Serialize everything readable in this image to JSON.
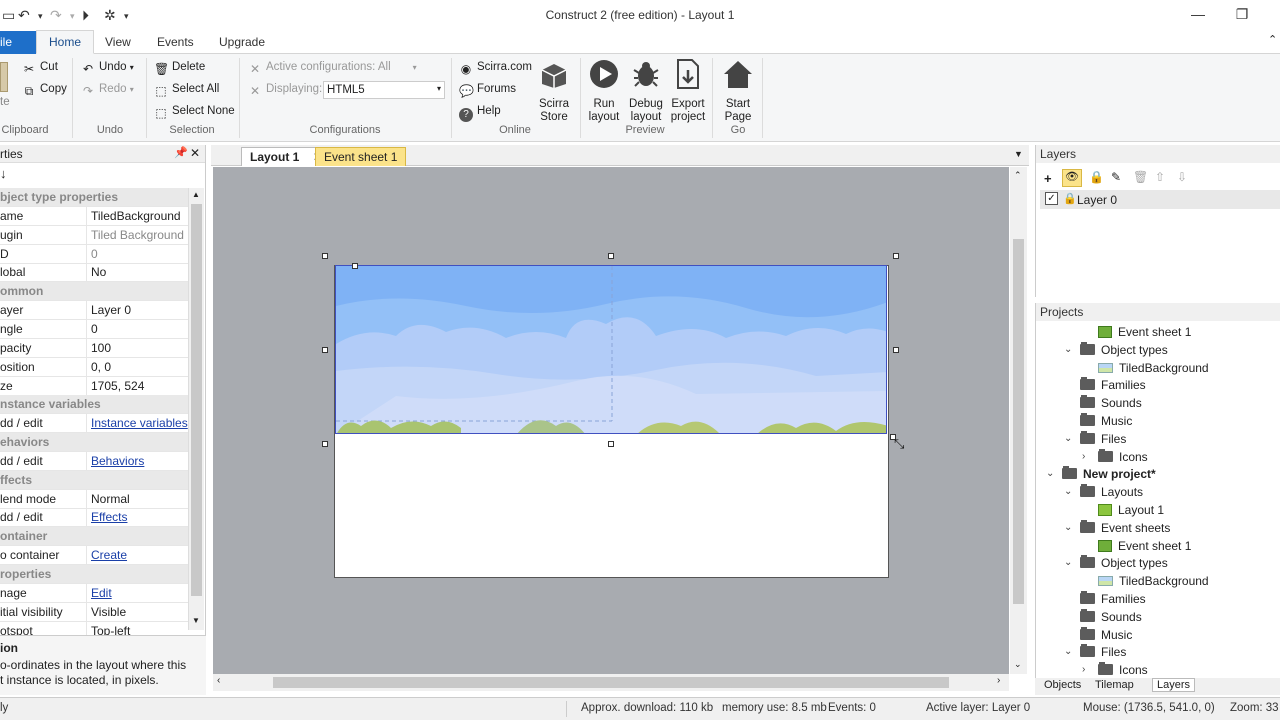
{
  "window": {
    "title": "Construct 2  (free edition) - Layout 1"
  },
  "ribbon_tabs": [
    "ile",
    "Home",
    "View",
    "Events",
    "Upgrade"
  ],
  "clipboard": {
    "cut": "Cut",
    "copy": "Copy",
    "paste": "te",
    "label": "Clipboard"
  },
  "undo": {
    "undo": "Undo",
    "redo": "Redo",
    "label": "Undo"
  },
  "selection": {
    "delete": "Delete",
    "select_all": "Select All",
    "select_none": "Select None",
    "label": "Selection"
  },
  "configurations": {
    "active": "Active configurations: All",
    "displaying_label": "Displaying:",
    "displaying_value": "HTML5",
    "label": "Configurations"
  },
  "online": {
    "scirra": "Scirra.com",
    "forums": "Forums",
    "help": "Help",
    "store_line1": "Scirra",
    "store_line2": "Store",
    "label": "Online"
  },
  "preview": {
    "run_line1": "Run",
    "run_line2": "layout",
    "debug_line1": "Debug",
    "debug_line2": "layout",
    "export_line1": "Export",
    "export_line2": "project",
    "label": "Preview"
  },
  "go": {
    "start_line1": "Start",
    "start_line2": "Page",
    "label": "Go"
  },
  "properties": {
    "header": "rties",
    "sort_icon": "↓",
    "rows": [
      {
        "k": "bject type properties",
        "v": "",
        "cat": true
      },
      {
        "k": "ame",
        "v": "TiledBackground"
      },
      {
        "k": "ugin",
        "v": "Tiled Background",
        "grey": true
      },
      {
        "k": "D",
        "v": "0",
        "grey": true
      },
      {
        "k": "lobal",
        "v": "No"
      },
      {
        "k": "ommon",
        "v": "",
        "cat": true
      },
      {
        "k": "ayer",
        "v": "Layer 0"
      },
      {
        "k": "ngle",
        "v": "0"
      },
      {
        "k": "pacity",
        "v": "100"
      },
      {
        "k": "osition",
        "v": "0, 0"
      },
      {
        "k": "ze",
        "v": "1705, 524"
      },
      {
        "k": "nstance variables",
        "v": "",
        "cat": true
      },
      {
        "k": "dd / edit",
        "v": "Instance variables",
        "link": true
      },
      {
        "k": "ehaviors",
        "v": "",
        "cat": true
      },
      {
        "k": "dd / edit",
        "v": "Behaviors",
        "link": true
      },
      {
        "k": "ffects",
        "v": "",
        "cat": true
      },
      {
        "k": "lend mode",
        "v": "Normal"
      },
      {
        "k": "dd / edit",
        "v": "Effects",
        "link": true
      },
      {
        "k": "ontainer",
        "v": "",
        "cat": true
      },
      {
        "k": "o container",
        "v": "Create",
        "link": true
      },
      {
        "k": "roperties",
        "v": "",
        "cat": true
      },
      {
        "k": "nage",
        "v": "Edit",
        "link": true
      },
      {
        "k": "itial visibility",
        "v": "Visible"
      },
      {
        "k": "otspot",
        "v": "Top-left"
      }
    ],
    "desc_title": "ion",
    "desc_line1": "o-ordinates in the layout where this",
    "desc_line2": "t instance is located, in pixels."
  },
  "doc_tabs": [
    "Layout 1",
    "Event sheet 1"
  ],
  "layers": {
    "header": "Layers",
    "items": [
      "Layer 0"
    ]
  },
  "projects": {
    "header": "Projects",
    "tree": [
      {
        "label": "Event sheet 1",
        "icon": "sheet"
      },
      {
        "label": "Object types",
        "icon": "folder"
      },
      {
        "label": "TiledBackground",
        "icon": "tbg"
      },
      {
        "label": "Families",
        "icon": "folder"
      },
      {
        "label": "Sounds",
        "icon": "folder"
      },
      {
        "label": "Music",
        "icon": "folder"
      },
      {
        "label": "Files",
        "icon": "folder"
      },
      {
        "label": "Icons",
        "icon": "folder"
      },
      {
        "label": "New project*",
        "icon": "folder",
        "bold": true
      },
      {
        "label": "Layouts",
        "icon": "folder"
      },
      {
        "label": "Layout 1",
        "icon": "layout"
      },
      {
        "label": "Event sheets",
        "icon": "folder"
      },
      {
        "label": "Event sheet 1",
        "icon": "sheet"
      },
      {
        "label": "Object types",
        "icon": "folder"
      },
      {
        "label": "TiledBackground",
        "icon": "tbg"
      },
      {
        "label": "Families",
        "icon": "folder"
      },
      {
        "label": "Sounds",
        "icon": "folder"
      },
      {
        "label": "Music",
        "icon": "folder"
      },
      {
        "label": "Files",
        "icon": "folder"
      },
      {
        "label": "Icons",
        "icon": "folder"
      }
    ]
  },
  "bottom_tabs": [
    "Objects",
    "Tilemap",
    "Layers"
  ],
  "status": {
    "left": "ly",
    "download": "Approx. download: 110 kb",
    "memory": "memory use: 8.5 mb",
    "events": "Events: 0",
    "active_layer": "Active layer: Layer 0",
    "mouse": "Mouse: (1736.5, 541.0, 0)",
    "zoom": "Zoom: 33"
  },
  "colors": {
    "accent": "#1e6fc9",
    "canvas_bg": "#a8abb0",
    "sky": "#7fb2f5",
    "link": "#1a3fa8"
  }
}
